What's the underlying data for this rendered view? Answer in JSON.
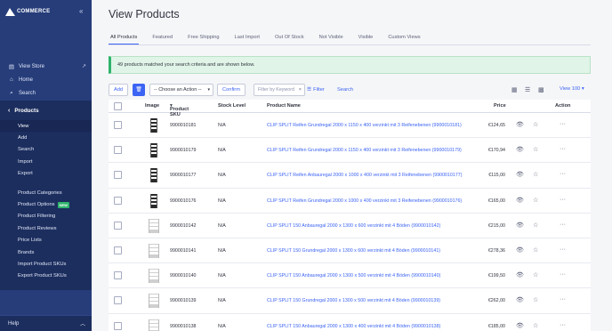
{
  "sidebar": {
    "brand": "COMMERCE",
    "nav": [
      {
        "label": "View Store",
        "icon": "store-icon"
      },
      {
        "label": "Home",
        "icon": "home-icon"
      },
      {
        "label": "Search",
        "icon": "search-icon"
      }
    ],
    "section": "Products",
    "sub_primary": [
      "View",
      "Add",
      "Search",
      "Import",
      "Export"
    ],
    "sub_secondary": [
      "Product Categories",
      "Product Options",
      "Product Filtering",
      "Product Reviews",
      "Price Lists",
      "Brands",
      "Import Product SKUs",
      "Export Product SKUs"
    ],
    "new_badge": "NEW",
    "help": "Help"
  },
  "page": {
    "title": "View Products",
    "tabs": [
      "All Products",
      "Featured",
      "Free Shipping",
      "Last Import",
      "Out Of Stock",
      "Not Visible",
      "Visible",
      "Custom Views"
    ],
    "alert": "49 products matched your search criteria and are shown below."
  },
  "toolbar": {
    "add": "Add",
    "action_select": "-- Choose an Action --",
    "confirm": "Confirm",
    "search_placeholder": "Filter by Keyword",
    "filter": "Filter",
    "search": "Search",
    "view_per": "View 100"
  },
  "table": {
    "headers": {
      "image": "Image",
      "sku": "Product SKU",
      "stock": "Stock Level",
      "name": "Product Name",
      "price": "Price",
      "action": "Action"
    },
    "rows": [
      {
        "sku": "9900010181",
        "stock": "N/A",
        "name": "CLIP SPLIT Reifen Grundregal 2000 x 1150 x 400 verzinkt mit 3 Reifenebenen (9900010181)",
        "price": "€124,65",
        "thumb": "dark"
      },
      {
        "sku": "9900010179",
        "stock": "N/A",
        "name": "CLIP SPLIT Reifen Grundregal 2000 x 1150 x 400 verzinkt mit 3 Reifenebenen (9900010179)",
        "price": "€170,94",
        "thumb": "dark"
      },
      {
        "sku": "9900010177",
        "stock": "N/A",
        "name": "CLIP SPLIT Reifen Anbauregal 2000 x 1000 x 400 verzinkt mit 3 Reifenebenen (9900010177)",
        "price": "€115,00",
        "thumb": "dark"
      },
      {
        "sku": "9900010176",
        "stock": "N/A",
        "name": "CLIP SPLIT Reifen Grundregal 2000 x 1000 x 400 verzinkt mit 3 Reifenebenen (9900010176)",
        "price": "€165,00",
        "thumb": "dark"
      },
      {
        "sku": "9900010142",
        "stock": "N/A",
        "name": "CLIP SPLIT 150 Anbauregal 2000 x 1300 x 600 verzinkt mit 4 Böden (9900010142)",
        "price": "€215,00",
        "thumb": "light"
      },
      {
        "sku": "9900010141",
        "stock": "N/A",
        "name": "CLIP SPLIT 150 Grundregal 2000 x 1300 x 600 verzinkt mit 4 Böden (9900010141)",
        "price": "€278,36",
        "thumb": "light"
      },
      {
        "sku": "9900010140",
        "stock": "N/A",
        "name": "CLIP SPLIT 150 Anbauregal 2000 x 1300 x 500 verzinkt mit 4 Böden (9900010140)",
        "price": "€199,50",
        "thumb": "light"
      },
      {
        "sku": "9900010139",
        "stock": "N/A",
        "name": "CLIP SPLIT 150 Grundregal 2000 x 1300 x 500 verzinkt mit 4 Böden (9900010139)",
        "price": "€262,00",
        "thumb": "light"
      },
      {
        "sku": "9900010138",
        "stock": "N/A",
        "name": "CLIP SPLIT 150 Anbauregal 2000 x 1300 x 400 verzinkt mit 4 Böden (9900010138)",
        "price": "€185,00",
        "thumb": "light"
      }
    ]
  },
  "colors": {
    "sidebar": "#263d7a",
    "accent": "#3c64f4",
    "success": "#2fb36c"
  }
}
